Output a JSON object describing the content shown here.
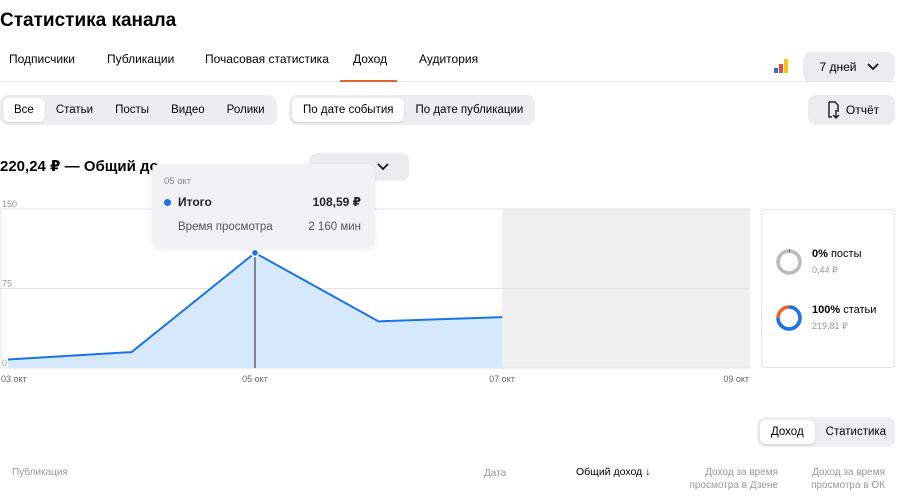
{
  "page": {
    "title": "Статистика канала"
  },
  "tabs": [
    {
      "label": "Подписчики"
    },
    {
      "label": "Публикации"
    },
    {
      "label": "Почасовая статистика"
    },
    {
      "label": "Доход",
      "active": true
    },
    {
      "label": "Аудитория"
    }
  ],
  "period": {
    "label": "7 дней"
  },
  "content_filter": {
    "options": [
      "Все",
      "Статьи",
      "Посты",
      "Видео",
      "Ролики"
    ],
    "selected": "Все"
  },
  "date_filter": {
    "options": [
      "По дате события",
      "По дате публикации"
    ],
    "selected": "По дате события"
  },
  "report_button": {
    "label": "Отчёт"
  },
  "summary": {
    "title": "220,24 ₽ — Общий до"
  },
  "tooltip": {
    "date": "05 окт",
    "row1_label": "Итого",
    "row1_value": "108,59 ₽",
    "row2_label": "Время просмотра",
    "row2_value": "2 160 мин"
  },
  "chart_data": {
    "type": "area",
    "x": [
      "03 окт",
      "04 окт",
      "05 окт",
      "06 окт",
      "07 окт"
    ],
    "values": [
      8,
      15,
      108.59,
      44,
      48
    ],
    "xticks": [
      "03 окт",
      "05 окт",
      "07 окт",
      "09 окт"
    ],
    "yticks": [
      "150",
      "75",
      "0"
    ],
    "ylim": [
      0,
      150
    ],
    "color": "#1a73e8",
    "fill": "#d6e8fb",
    "future_range": [
      "07 окт",
      "09 окт"
    ],
    "highlight_index": 2
  },
  "breakdown": [
    {
      "pct": "0%",
      "label": "посты",
      "amount": "0,44 ₽",
      "color": "#bbbbbb"
    },
    {
      "pct": "100%",
      "label": "статьи",
      "amount": "219,81 ₽",
      "color": "#e8612c"
    }
  ],
  "table_toggle": {
    "options": [
      "Доход",
      "Статистика"
    ],
    "selected": "Доход"
  },
  "table_headers": {
    "publication": "Публикация",
    "date": "Дата",
    "total": "Общий доход",
    "sort_arrow": "↓",
    "dzen_l1": "Доход за время",
    "dzen_l2": "просмотра в Дзене",
    "ok_l1": "Доход за время",
    "ok_l2": "просмотра в ОК"
  },
  "colors": {
    "accent": "#e1653a",
    "line": "#1a73e8",
    "pill_bg": "#eeeef0"
  }
}
